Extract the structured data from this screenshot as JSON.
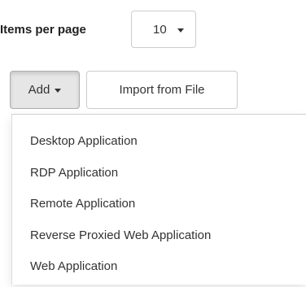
{
  "pagination": {
    "items_per_page_label": "Items per page",
    "items_per_page_value": "10"
  },
  "toolbar": {
    "add_label": "Add",
    "import_label": "Import from File"
  },
  "add_menu": {
    "items": [
      {
        "label": "Desktop Application"
      },
      {
        "label": "RDP Application"
      },
      {
        "label": "Remote Application"
      },
      {
        "label": "Reverse Proxied Web Application"
      },
      {
        "label": "Web Application"
      }
    ]
  },
  "icons": {
    "select_caret": "chevron-down-icon",
    "add_caret": "caret-down-icon"
  }
}
